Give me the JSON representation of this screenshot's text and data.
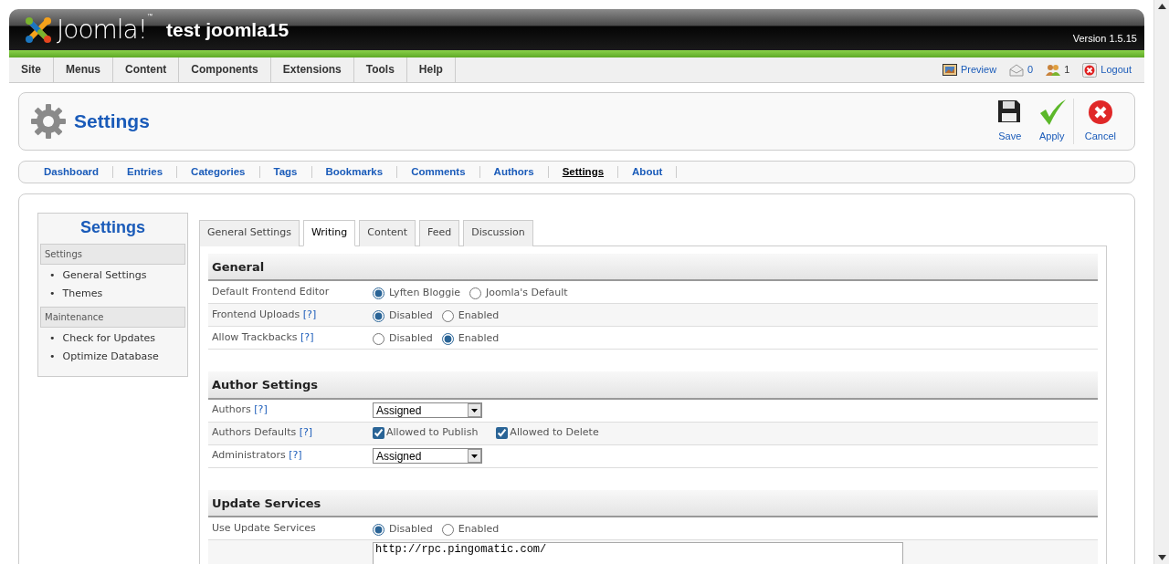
{
  "header": {
    "logo_text": "Joomla!",
    "logo_mark": "™",
    "site_title": "test joomla15",
    "version": "Version 1.5.15"
  },
  "menu": [
    {
      "label": "Site"
    },
    {
      "label": "Menus"
    },
    {
      "label": "Content"
    },
    {
      "label": "Components"
    },
    {
      "label": "Extensions"
    },
    {
      "label": "Tools"
    },
    {
      "label": "Help"
    }
  ],
  "status": [
    {
      "kind": "preview",
      "label": "Preview"
    },
    {
      "kind": "messages",
      "label": "0"
    },
    {
      "kind": "users",
      "label": "1"
    },
    {
      "kind": "logout",
      "label": "Logout"
    }
  ],
  "toolbar": {
    "title": "Settings",
    "buttons": [
      {
        "kind": "save",
        "label": "Save"
      },
      {
        "kind": "apply",
        "label": "Apply"
      },
      {
        "kind": "cancel",
        "label": "Cancel"
      }
    ]
  },
  "submenu": [
    {
      "label": "Dashboard",
      "selected": false
    },
    {
      "label": "Entries",
      "selected": false
    },
    {
      "label": "Categories",
      "selected": false
    },
    {
      "label": "Tags",
      "selected": false
    },
    {
      "label": "Bookmarks",
      "selected": false
    },
    {
      "label": "Comments",
      "selected": false
    },
    {
      "label": "Authors",
      "selected": false
    },
    {
      "label": "Settings",
      "selected": true
    },
    {
      "label": "About",
      "selected": false
    }
  ],
  "sidebar": {
    "title": "Settings",
    "groups": [
      {
        "heading": "Settings",
        "items": [
          {
            "bullet": "•",
            "label": "General Settings"
          },
          {
            "bullet": "•",
            "label": "Themes"
          }
        ]
      },
      {
        "heading": "Maintenance",
        "items": [
          {
            "bullet": "•",
            "label": "Check for Updates"
          },
          {
            "bullet": "•",
            "label": "Optimize Database"
          }
        ]
      }
    ]
  },
  "tabs": [
    {
      "label": "General Settings",
      "selected": false
    },
    {
      "label": "Writing",
      "selected": true
    },
    {
      "label": "Content",
      "selected": false
    },
    {
      "label": "Feed",
      "selected": false
    },
    {
      "label": "Discussion",
      "selected": false
    }
  ],
  "sections": [
    {
      "title": "General",
      "rows": [
        {
          "label": "Default Frontend Editor",
          "kind": "radio",
          "options": [
            {
              "label": "Lyften Bloggie",
              "selected": true
            },
            {
              "label": "Joomla's Default",
              "selected": false
            }
          ]
        },
        {
          "label": "Frontend Uploads",
          "help": "[?]",
          "kind": "radio",
          "options": [
            {
              "label": "Disabled",
              "selected": true
            },
            {
              "label": "Enabled",
              "selected": false
            }
          ]
        },
        {
          "label": "Allow Trackbacks",
          "help": "[?]",
          "kind": "radio",
          "options": [
            {
              "label": "Disabled",
              "selected": false
            },
            {
              "label": "Enabled",
              "selected": true
            }
          ]
        }
      ]
    },
    {
      "title": "Author Settings",
      "rows": [
        {
          "label": "Authors",
          "help": "[?]",
          "kind": "select",
          "value": "Assigned"
        },
        {
          "label": "Authors Defaults",
          "help": "[?]",
          "kind": "checkbox",
          "options": [
            {
              "label": "Allowed to Publish",
              "checked": true
            },
            {
              "label": "Allowed to Delete",
              "checked": true
            }
          ]
        },
        {
          "label": "Administrators",
          "help": "[?]",
          "kind": "select",
          "value": "Assigned"
        }
      ]
    },
    {
      "title": "Update Services",
      "rows": [
        {
          "label": "Use Update Services",
          "kind": "radio",
          "options": [
            {
              "label": "Disabled",
              "selected": true
            },
            {
              "label": "Enabled",
              "selected": false
            }
          ]
        },
        {
          "kind": "textarea",
          "value": "http://rpc.pingomatic.com/"
        }
      ]
    }
  ]
}
